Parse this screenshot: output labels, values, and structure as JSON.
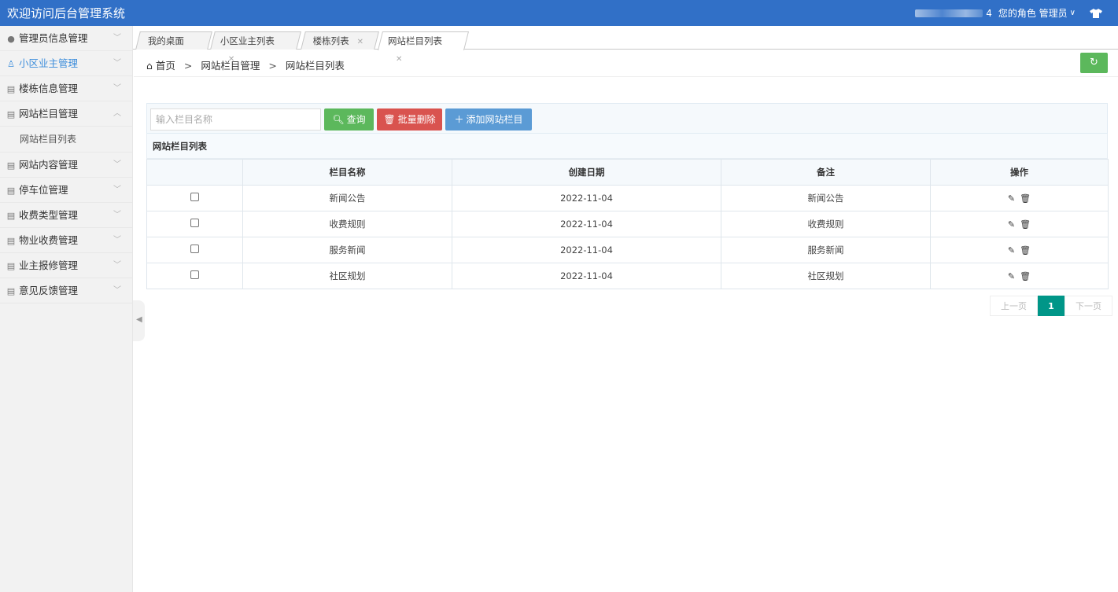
{
  "header": {
    "app_title": "欢迎访问后台管理系统",
    "user_suffix": "4",
    "role_label": "您的角色 管理员",
    "caret": "∨"
  },
  "sidebar": {
    "items": [
      {
        "icon": "user-icon",
        "label": "管理员信息管理"
      },
      {
        "icon": "users-icon",
        "label": "小区业主管理"
      },
      {
        "icon": "list-icon",
        "label": "楼栋信息管理"
      },
      {
        "icon": "list-icon",
        "label": "网站栏目管理"
      },
      {
        "icon": "list-icon",
        "label": "网站内容管理"
      },
      {
        "icon": "list-icon",
        "label": "停车位管理"
      },
      {
        "icon": "list-icon",
        "label": "收费类型管理"
      },
      {
        "icon": "list-icon",
        "label": "物业收费管理"
      },
      {
        "icon": "list-icon",
        "label": "业主报修管理"
      },
      {
        "icon": "list-icon",
        "label": "意见反馈管理"
      }
    ],
    "sub_item": "网站栏目列表"
  },
  "tabs": [
    {
      "label": "我的桌面",
      "closable": false
    },
    {
      "label": "小区业主列表",
      "closable": true
    },
    {
      "label": "楼栋列表",
      "closable": true
    },
    {
      "label": "网站栏目列表",
      "closable": true,
      "active": true
    }
  ],
  "breadcrumb": {
    "home": "首页",
    "sep": ">",
    "level1": "网站栏目管理",
    "level2": "网站栏目列表"
  },
  "toolbar": {
    "search_placeholder": "输入栏目名称",
    "query_label": "查询",
    "delete_label": "批量删除",
    "add_label": "添加网站栏目"
  },
  "list": {
    "title": "网站栏目列表",
    "columns": [
      "",
      "栏目名称",
      "创建日期",
      "备注",
      "操作"
    ],
    "rows": [
      {
        "name": "新闻公告",
        "date": "2022-11-04",
        "note": "新闻公告"
      },
      {
        "name": "收费规则",
        "date": "2022-11-04",
        "note": "收费规则"
      },
      {
        "name": "服务新闻",
        "date": "2022-11-04",
        "note": "服务新闻"
      },
      {
        "name": "社区规划",
        "date": "2022-11-04",
        "note": "社区规划"
      }
    ]
  },
  "pagination": {
    "prev": "上一页",
    "current": "1",
    "next": "下一页"
  },
  "colors": {
    "topbar": "#3170c7",
    "success": "#5cb85c",
    "danger": "#d9534f",
    "primary": "#5b9bd5",
    "pager_active": "#009688"
  }
}
